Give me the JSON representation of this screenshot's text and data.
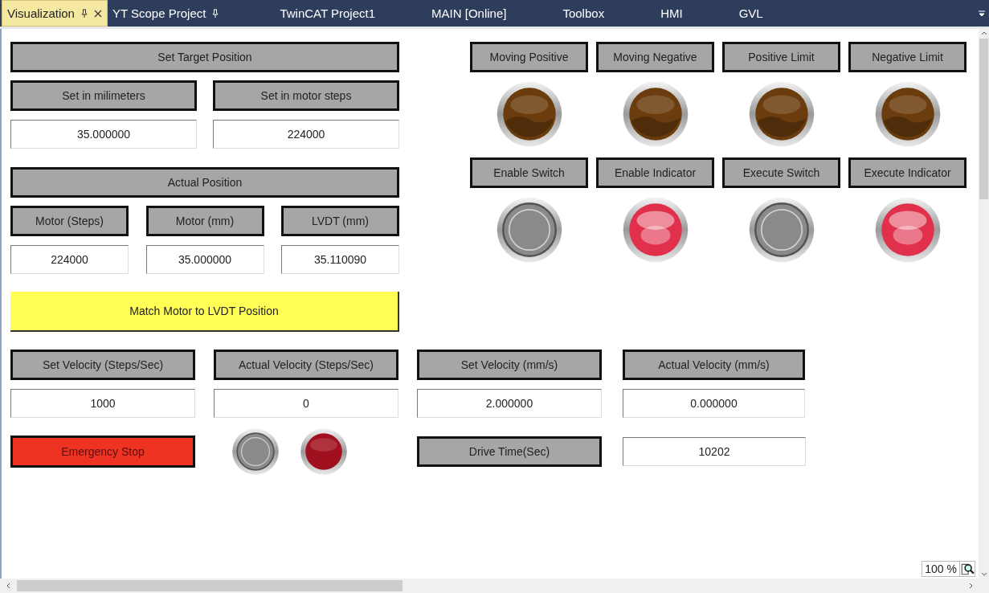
{
  "tabs": [
    {
      "label": "Visualization",
      "selected": true,
      "pinned": true,
      "closable": true
    },
    {
      "label": "YT Scope Project",
      "selected": false,
      "pinned": true,
      "closable": false
    },
    {
      "label": "TwinCAT Project1",
      "selected": false,
      "pinned": false,
      "closable": false
    },
    {
      "label": "MAIN [Online]",
      "selected": false,
      "pinned": false,
      "closable": false
    },
    {
      "label": "Toolbox",
      "selected": false,
      "pinned": false,
      "closable": false
    },
    {
      "label": "HMI",
      "selected": false,
      "pinned": false,
      "closable": false
    },
    {
      "label": "GVL",
      "selected": false,
      "pinned": false,
      "closable": false
    }
  ],
  "target": {
    "header": "Set Target Position",
    "columns": [
      {
        "label": "Set in milimeters",
        "value": "35.000000"
      },
      {
        "label": "Set in motor steps",
        "value": "224000"
      }
    ]
  },
  "actual": {
    "header": "Actual Position",
    "columns": [
      {
        "label": "Motor (Steps)",
        "value": "224000"
      },
      {
        "label": "Motor (mm)",
        "value": "35.000000"
      },
      {
        "label": "LVDT (mm)",
        "value": "35.110090"
      }
    ]
  },
  "match_button": "Match Motor to LVDT Position",
  "indicators": [
    {
      "label": "Moving Positive",
      "kind": "lamp",
      "on": false,
      "color": "#6b3d0e"
    },
    {
      "label": "Moving Negative",
      "kind": "lamp",
      "on": false,
      "color": "#6b3d0e"
    },
    {
      "label": "Positive Limit",
      "kind": "lamp",
      "on": false,
      "color": "#6b3d0e"
    },
    {
      "label": "Negative Limit",
      "kind": "lamp",
      "on": false,
      "color": "#6b3d0e"
    },
    {
      "label": "Enable Switch",
      "kind": "switch",
      "on": false
    },
    {
      "label": "Enable Indicator",
      "kind": "lamp",
      "on": true,
      "color": "#e0304c"
    },
    {
      "label": "Execute Switch",
      "kind": "switch",
      "on": false
    },
    {
      "label": "Execute Indicator",
      "kind": "lamp",
      "on": true,
      "color": "#e0304c"
    }
  ],
  "velocity": [
    {
      "label": "Set Velocity (Steps/Sec)",
      "value": "1000"
    },
    {
      "label": "Actual Velocity (Steps/Sec)",
      "value": "0"
    },
    {
      "label": "Set Velocity (mm/s)",
      "value": "2.000000"
    },
    {
      "label": "Actual Velocity (mm/s)",
      "value": "0.000000"
    }
  ],
  "emergency": {
    "label": "Emergency Stop",
    "lamps": [
      {
        "kind": "switch",
        "on": false
      },
      {
        "kind": "lamp",
        "on": false,
        "color": "#a0101e"
      }
    ]
  },
  "drive_time": {
    "label": "Drive Time(Sec)",
    "value": "10202"
  },
  "zoom": "100 %"
}
